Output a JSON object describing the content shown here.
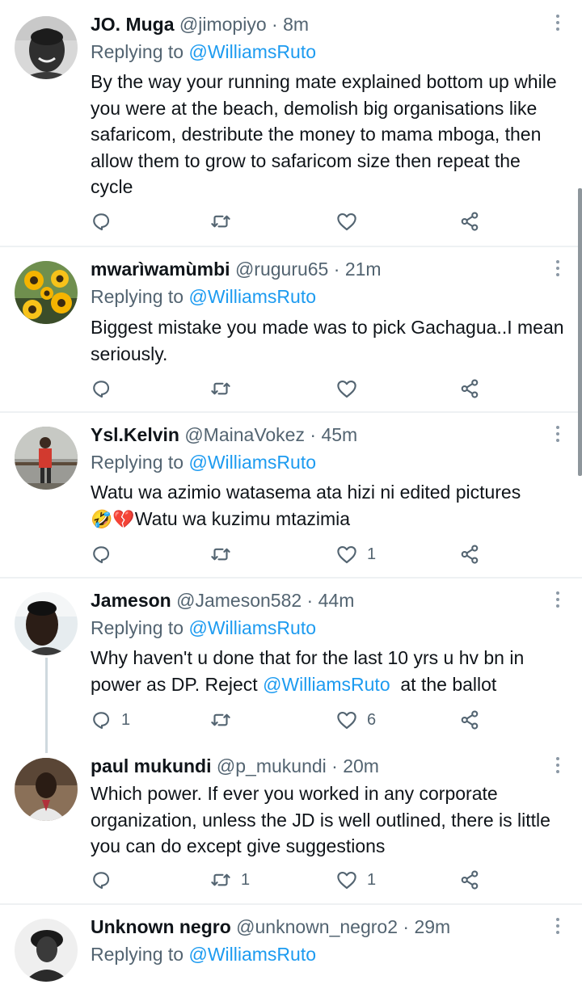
{
  "tweets": [
    {
      "name": "JO. Muga",
      "handle": "@jimopiyo",
      "time": "8m",
      "replying_prefix": "Replying to ",
      "replying_to": "@WilliamsRuto",
      "body": "By the way your running mate explained bottom up while you were at the beach, demolish big organisations like safaricom, destribute the money to mama mboga, then allow them to grow to safaricom size then repeat the cycle",
      "reply_count": "",
      "retweet_count": "",
      "like_count": ""
    },
    {
      "name": "mwarìwamùmbi",
      "handle": "@ruguru65",
      "time": "21m",
      "replying_prefix": "Replying to ",
      "replying_to": "@WilliamsRuto",
      "body": "Biggest mistake you made was to pick Gachagua..I mean seriously.",
      "reply_count": "",
      "retweet_count": "",
      "like_count": ""
    },
    {
      "name": "Ysl.Kelvin",
      "handle": "@MainaVokez",
      "time": "45m",
      "replying_prefix": "Replying to ",
      "replying_to": "@WilliamsRuto",
      "body_line1": "Watu wa azimio watasema ata hizi ni edited pictures",
      "emojis": "🤣💔",
      "body_line2": "Watu wa kuzimu mtazimia",
      "reply_count": "",
      "retweet_count": "",
      "like_count": "1"
    },
    {
      "name": "Jameson",
      "handle": "@Jameson582",
      "time": "44m",
      "replying_prefix": "Replying to ",
      "replying_to": "@WilliamsRuto",
      "body_before": "Why haven't u done that for the last 10 yrs u hv bn in power as DP. Reject ",
      "body_mention": "@WilliamsRuto",
      "body_after": "  at the ballot",
      "reply_count": "1",
      "retweet_count": "",
      "like_count": "6"
    },
    {
      "name": "paul mukundi",
      "handle": "@p_mukundi",
      "time": "20m",
      "body": "Which power. If ever you worked in any corporate organization, unless the JD is well outlined, there is little you can do except give suggestions",
      "reply_count": "",
      "retweet_count": "1",
      "like_count": "1"
    },
    {
      "name": "Unknown negro",
      "handle": "@unknown_negro2",
      "time": "29m",
      "replying_prefix": "Replying to ",
      "replying_to": "@WilliamsRuto"
    }
  ],
  "separator": " · ",
  "colors": {
    "text": "#0f1419",
    "secondary": "#536471",
    "link": "#1d9bf0",
    "divider": "#eef1f3",
    "thread_line": "#cfd9de"
  },
  "icons": {
    "reply": "reply-icon",
    "retweet": "retweet-icon",
    "like": "heart-icon",
    "share": "share-icon",
    "more": "more-options-icon"
  }
}
